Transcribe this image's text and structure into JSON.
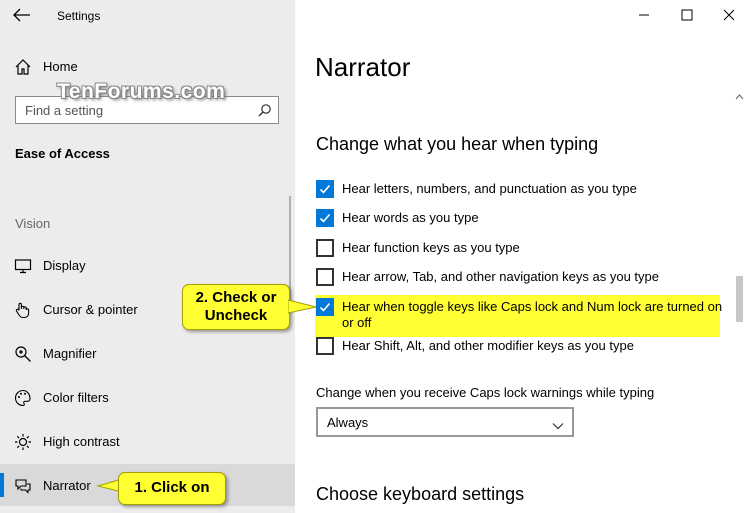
{
  "window": {
    "title": "Settings",
    "controls": [
      "minimize",
      "maximize",
      "close"
    ]
  },
  "sidebar": {
    "home_label": "Home",
    "search_placeholder": "Find a setting",
    "section_title": "Ease of Access",
    "group_label": "Vision",
    "items": [
      {
        "label": "Display",
        "icon": "monitor-icon"
      },
      {
        "label": "Cursor & pointer",
        "icon": "cursor-icon"
      },
      {
        "label": "Magnifier",
        "icon": "magnifier-icon"
      },
      {
        "label": "Color filters",
        "icon": "palette-icon"
      },
      {
        "label": "High contrast",
        "icon": "sun-icon"
      },
      {
        "label": "Narrator",
        "icon": "narrator-icon",
        "selected": true
      }
    ]
  },
  "watermark": "TenForums.com",
  "main": {
    "page_title": "Narrator",
    "section_typing": "Change what you hear when typing",
    "checkboxes": [
      {
        "label": "Hear letters, numbers, and punctuation as you type",
        "checked": true
      },
      {
        "label": "Hear words as you type",
        "checked": true
      },
      {
        "label": "Hear function keys as you type",
        "checked": false
      },
      {
        "label": "Hear arrow, Tab, and other navigation keys as you type",
        "checked": false
      },
      {
        "label": "Hear when toggle keys like Caps lock and Num lock are turned on or off",
        "checked": true
      },
      {
        "label": "Hear Shift, Alt, and other modifier keys as you type",
        "checked": false
      }
    ],
    "caps_warning_label": "Change when you receive Caps lock warnings while typing",
    "caps_warning_value": "Always",
    "section_keyboard": "Choose keyboard settings"
  },
  "callouts": {
    "step1": "1. Click on",
    "step2_line1": "2. Check or",
    "step2_line2": "Uncheck"
  },
  "colors": {
    "accent": "#0078d7",
    "highlight": "#ffff33",
    "sidebar_bg": "#ececec"
  }
}
